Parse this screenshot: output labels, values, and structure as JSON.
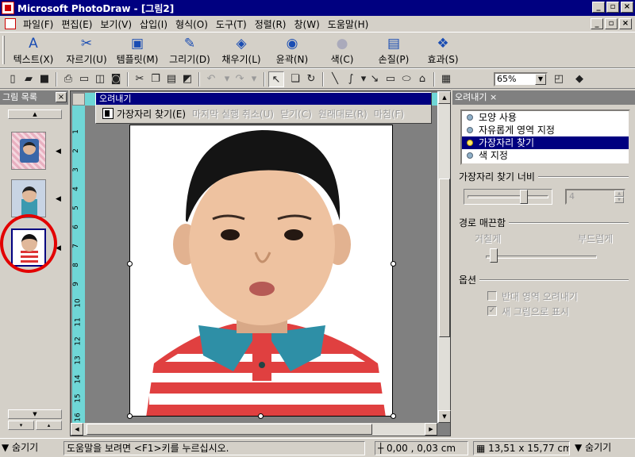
{
  "window": {
    "title": "Microsoft PhotoDraw - [그림2]"
  },
  "menubar": {
    "items": [
      "파일(F)",
      "편집(E)",
      "보기(V)",
      "삽입(I)",
      "형식(O)",
      "도구(T)",
      "정렬(R)",
      "창(W)",
      "도움말(H)"
    ]
  },
  "bigbar": {
    "items": [
      {
        "label": "텍스트(X)",
        "icon": "A"
      },
      {
        "label": "자르기(U)",
        "icon": "✂"
      },
      {
        "label": "템플릿(M)",
        "icon": "▣"
      },
      {
        "label": "그리기(D)",
        "icon": "✎"
      },
      {
        "label": "채우기(L)",
        "icon": "◈"
      },
      {
        "label": "윤곽(N)",
        "icon": "◉"
      },
      {
        "label": "색(C)",
        "icon": "●"
      },
      {
        "label": "손질(P)",
        "icon": "▤"
      },
      {
        "label": "효과(S)",
        "icon": "❖"
      }
    ]
  },
  "stdbar": {
    "zoom": "65%"
  },
  "thumbpanel": {
    "title": "그림 목록"
  },
  "crop_toolbar": {
    "title": "오려내기",
    "options": [
      {
        "label": "가장자리 찾기(E)",
        "enabled": true
      },
      {
        "label": "마지막 실행 취소(U)",
        "enabled": false
      },
      {
        "label": "닫기(C)",
        "enabled": false
      },
      {
        "label": "원래대로(R)",
        "enabled": false
      },
      {
        "label": "마침(F)",
        "enabled": false
      }
    ]
  },
  "rightpanel": {
    "title": "오려내기",
    "list": [
      "모양 사용",
      "자유롭게 영역 지정",
      "가장자리 찾기",
      "색 지정"
    ],
    "selected_index": 2,
    "edge_width_label": "가장자리 찾기 너비",
    "edge_width_value": "4",
    "edge_width_level": 0.72,
    "smooth_label": "경로 매끈함",
    "rough_label": "거칠게",
    "smooth_end_label": "부드럽게",
    "smooth_level": 0.05,
    "options_label": "옵션",
    "invert_label": "반대 영역 오려내기",
    "new_picture_label": "새 그림으로 표시"
  },
  "ruler": {
    "left_labels": [
      "1",
      "2",
      "3",
      "4",
      "5",
      "6",
      "7",
      "8",
      "9",
      "10",
      "11",
      "12",
      "13",
      "14",
      "15",
      "16"
    ]
  },
  "statusbar": {
    "hide_left": "숨기기",
    "help": "도움말을 보려면 <F1>키를 누르십시오.",
    "coords": "0,00 , 0,03 cm",
    "size": "13,51 x 15,77 cm",
    "hide_right": "숨기기"
  },
  "colors": {
    "titlebar": "#000080",
    "ruler": "#6fd6d6",
    "selection": "#000080",
    "annotation": "#e30000"
  }
}
